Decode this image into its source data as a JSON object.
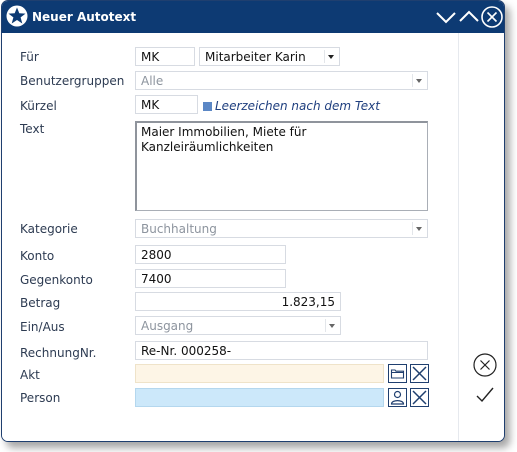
{
  "window": {
    "title": "Neuer Autotext"
  },
  "colors": {
    "titlebar": "#0d3a73",
    "akt_bg": "#fdf5e6",
    "person_bg": "#cce8fa",
    "checkbox": "#5b87c5"
  },
  "icons": {
    "app": "star-icon",
    "minimize": "chevron-down-icon",
    "maximize": "chevron-up-icon",
    "close": "close-circle-icon",
    "folder": "folder-icon",
    "clear": "x-icon",
    "person": "person-icon",
    "cancel": "cancel-circle-icon",
    "ok": "checkmark-icon"
  },
  "form": {
    "fuer": {
      "label": "Für",
      "code": "MK",
      "name": "Mitarbeiter Karin"
    },
    "benutzergruppen": {
      "label": "Benutzergruppen",
      "value": "Alle"
    },
    "kuerzel": {
      "label": "Kürzel",
      "value": "MK",
      "checkbox_label": "Leerzeichen nach dem Text"
    },
    "text": {
      "label": "Text",
      "value": "Maier Immobilien, Miete für Kanzleiräumlichkeiten"
    },
    "kategorie": {
      "label": "Kategorie",
      "value": "Buchhaltung"
    },
    "konto": {
      "label": "Konto",
      "value": "2800"
    },
    "gegenkonto": {
      "label": "Gegenkonto",
      "value": "7400"
    },
    "betrag": {
      "label": "Betrag",
      "value": "1.823,15"
    },
    "ein_aus": {
      "label": "Ein/Aus",
      "value": "Ausgang"
    },
    "rechnungnr": {
      "label": "RechnungNr.",
      "value": "Re-Nr. 000258-"
    },
    "akt": {
      "label": "Akt",
      "value": ""
    },
    "person": {
      "label": "Person",
      "value": ""
    }
  }
}
